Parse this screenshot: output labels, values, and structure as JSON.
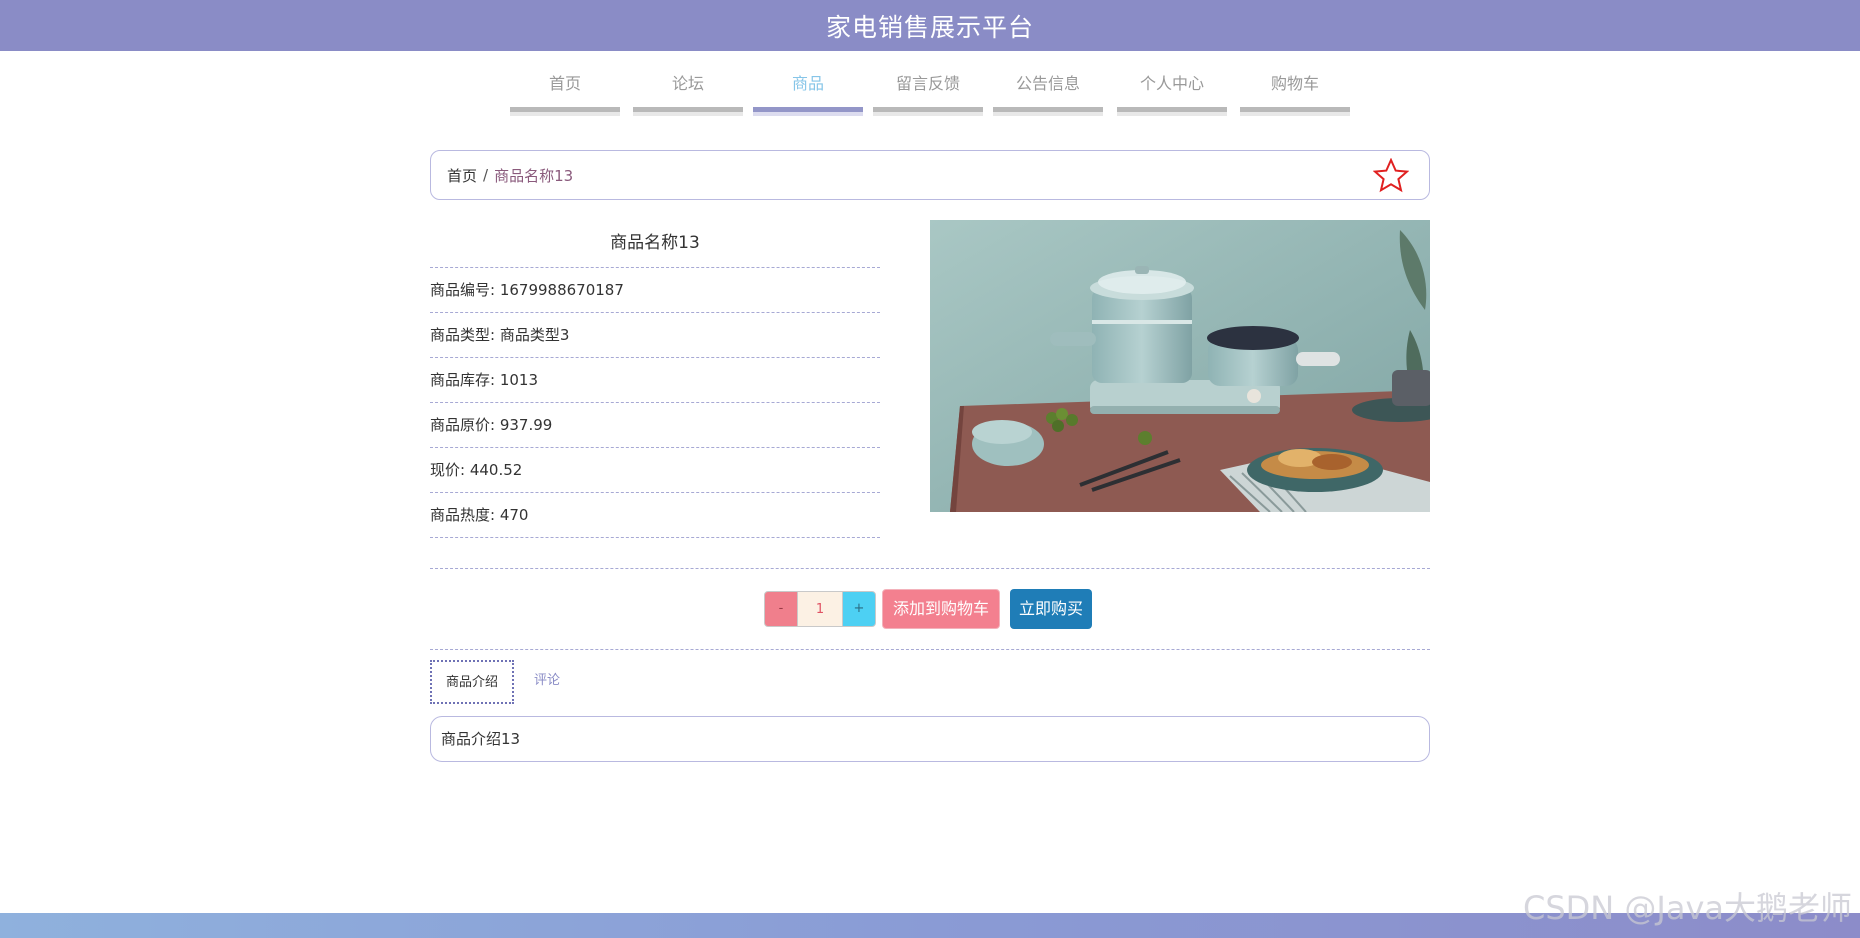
{
  "header": {
    "title": "家电销售展示平台"
  },
  "nav": {
    "items": [
      {
        "label": "首页"
      },
      {
        "label": "论坛"
      },
      {
        "label": "商品"
      },
      {
        "label": "留言反馈"
      },
      {
        "label": "公告信息"
      },
      {
        "label": "个人中心"
      },
      {
        "label": "购物车"
      }
    ],
    "active_index": 2,
    "active_color": "#86c5e8"
  },
  "breadcrumb": {
    "home": "首页",
    "separator": "/",
    "current": "商品名称13",
    "favorite_icon": "star-outline-icon",
    "favorite_color": "#e02020"
  },
  "product": {
    "name": "商品名称13",
    "rows": [
      {
        "text": "商品编号: 1679988670187"
      },
      {
        "text": "商品类型: 商品类型3"
      },
      {
        "text": "商品库存: 1013"
      },
      {
        "text": "商品原价: 937.99"
      },
      {
        "text": "现价: 440.52"
      },
      {
        "text": "商品热度: 470"
      }
    ],
    "image": "kitchen-appliance-photo"
  },
  "actions": {
    "minus": "-",
    "quantity": "1",
    "plus": "+",
    "add_to_cart": "添加到购物车",
    "buy_now": "立即购买"
  },
  "tabs": {
    "items": [
      {
        "label": "商品介绍"
      },
      {
        "label": "评论"
      }
    ],
    "active_index": 0
  },
  "intro": {
    "text": "商品介绍13"
  },
  "watermark": {
    "text": "CSDN @Java大鹅老师"
  },
  "colors": {
    "brand": "#8a8cc6",
    "cart_button": "#f3808f",
    "buy_button": "#1f7db7"
  }
}
